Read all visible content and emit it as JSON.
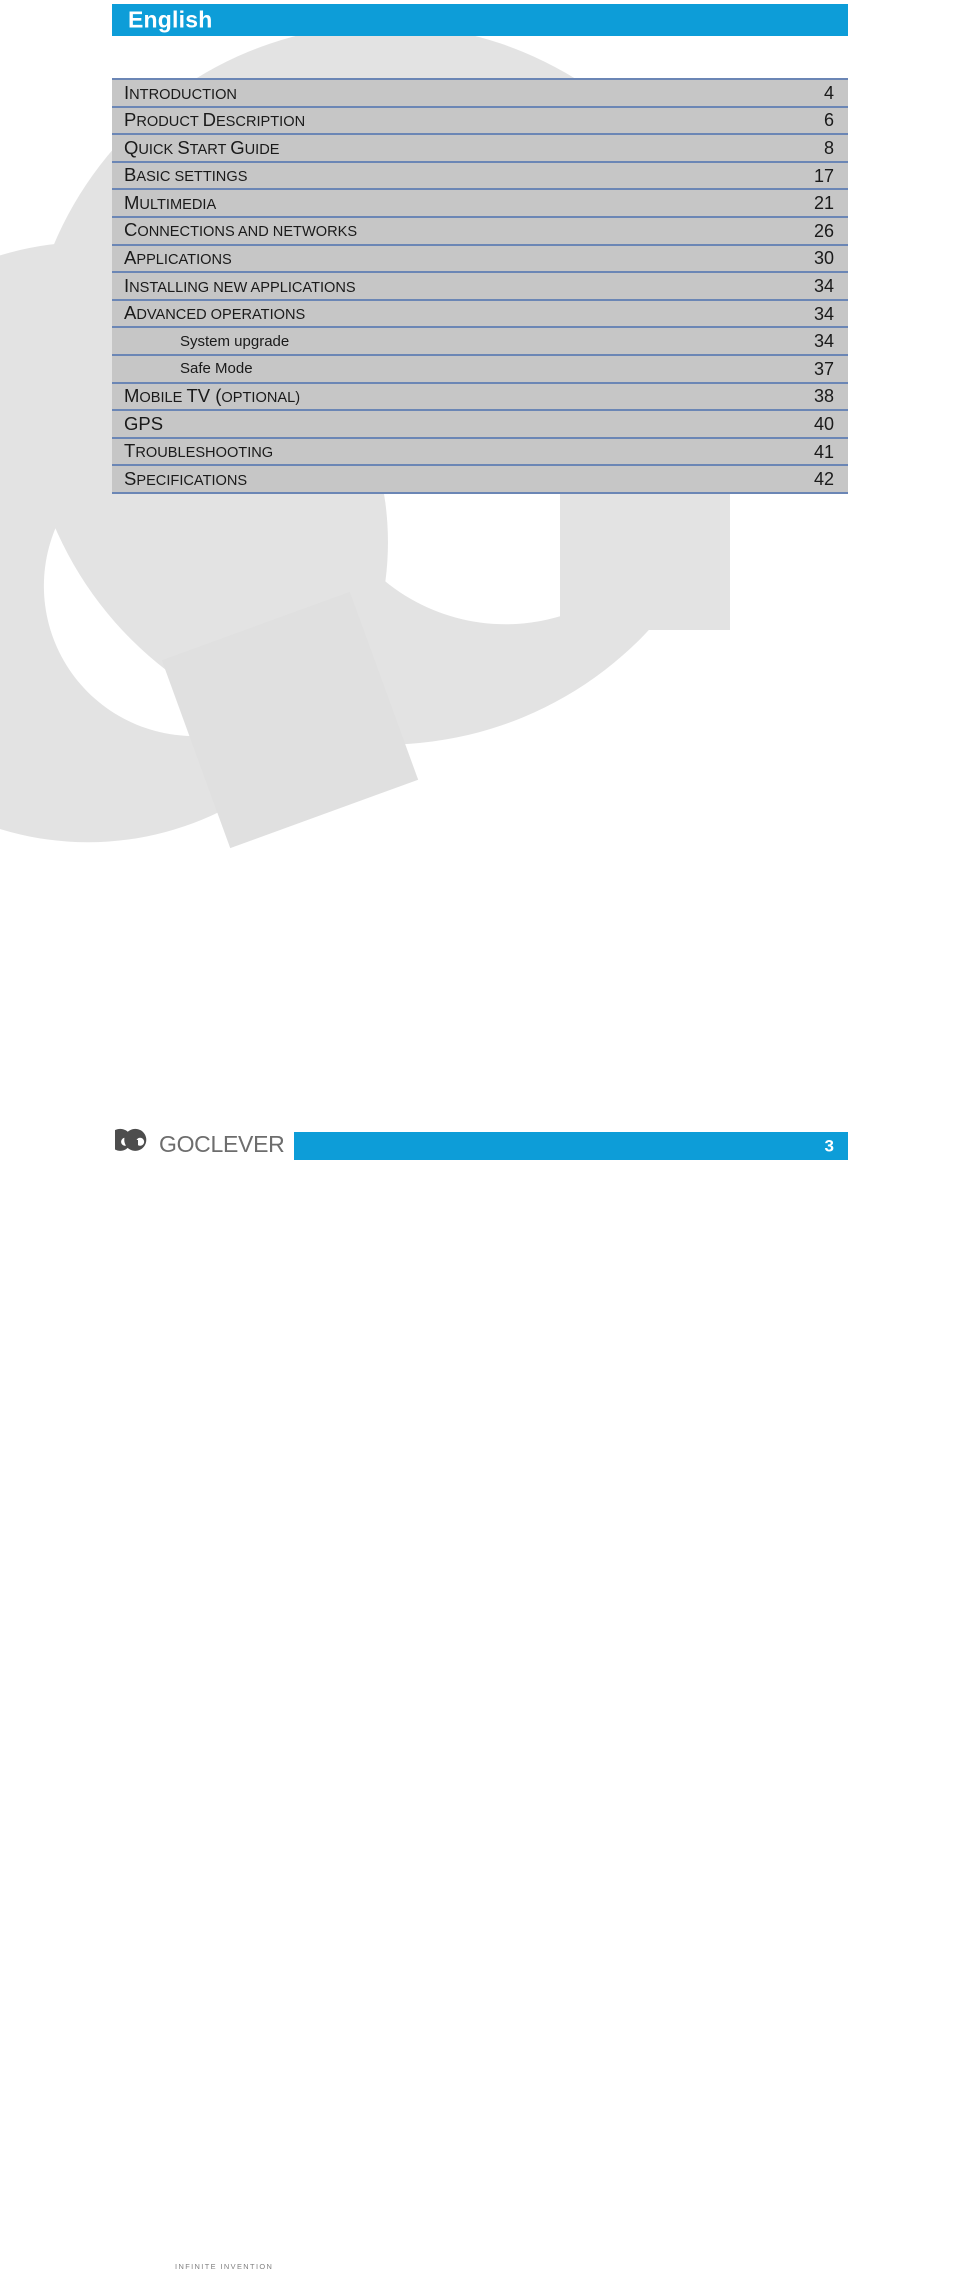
{
  "header": {
    "language_label": "English",
    "bar_color": "#0d9dd8"
  },
  "toc": {
    "row_separator_color": "#6b86b5",
    "band_color": "#c6c6c6",
    "entries": [
      {
        "label": "INTRODUCTION",
        "first": "I",
        "rest": "NTRODUCTION",
        "page": "4",
        "level": 1
      },
      {
        "label": "PRODUCT DESCRIPTION",
        "first": "P",
        "rest": "RODUCT ",
        "page": "6",
        "level": 1,
        "first2": "D",
        "rest2": "ESCRIPTION"
      },
      {
        "label": "QUICK START GUIDE",
        "first": "Q",
        "rest": "UICK ",
        "page": "8",
        "level": 1,
        "first2": "S",
        "rest2": "TART ",
        "first3": "G",
        "rest3": "UIDE"
      },
      {
        "label": "BASIC SETTINGS",
        "first": "B",
        "rest": "ASIC SETTINGS",
        "page": "17",
        "level": 1
      },
      {
        "label": "MULTIMEDIA",
        "first": "M",
        "rest": "ULTIMEDIA",
        "page": "21",
        "level": 1
      },
      {
        "label": "CONNECTIONS AND NETWORKS",
        "first": "C",
        "rest": "ONNECTIONS AND NETWORKS",
        "page": "26",
        "level": 1
      },
      {
        "label": "APPLICATIONS",
        "first": "A",
        "rest": "PPLICATIONS",
        "page": "30",
        "level": 1
      },
      {
        "label": "INSTALLING NEW APPLICATIONS",
        "first": "I",
        "rest": "NSTALLING NEW APPLICATIONS",
        "page": "34",
        "level": 1
      },
      {
        "label": "ADVANCED OPERATIONS",
        "first": "A",
        "rest": "DVANCED OPERATIONS",
        "page": "34",
        "level": 1
      },
      {
        "label": "System upgrade",
        "first": "",
        "rest": "System upgrade",
        "page": "34",
        "level": 2
      },
      {
        "label": "Safe Mode",
        "first": "",
        "rest": "Safe Mode",
        "page": "37",
        "level": 2
      },
      {
        "label": "MOBILE TV (OPTIONAL)",
        "first": "M",
        "rest": "OBILE ",
        "page": "38",
        "level": 1,
        "first2": "TV (",
        "rest2": "OPTIONAL)"
      },
      {
        "label": "GPS",
        "first": "GPS",
        "rest": "",
        "page": "40",
        "level": 1
      },
      {
        "label": "TROUBLESHOOTING",
        "first": "T",
        "rest": "ROUBLESHOOTING",
        "page": "41",
        "level": 1
      },
      {
        "label": "SPECIFICATIONS",
        "first": "S",
        "rest": "PECIFICATIONS",
        "page": "42",
        "level": 1
      }
    ]
  },
  "footer": {
    "logo_mark": "GO",
    "logo_wordmark": "GOCLEVER",
    "logo_tagline": "INFINITE INVENTION",
    "page_number": "3",
    "bar_color": "#0d9dd8"
  },
  "watermark": {
    "description": "GO logo mark",
    "color": "#e3e3e3"
  }
}
